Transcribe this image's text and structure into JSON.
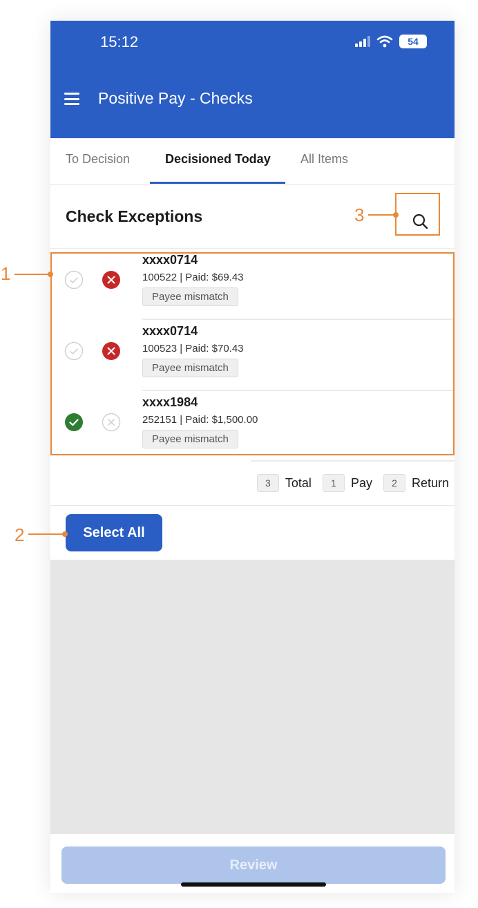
{
  "status": {
    "time": "15:12",
    "battery": "54"
  },
  "header": {
    "title": "Positive Pay - Checks"
  },
  "tabs": [
    {
      "label": "To Decision"
    },
    {
      "label": "Decisioned Today"
    },
    {
      "label": "All Items"
    }
  ],
  "section": {
    "title": "Check Exceptions"
  },
  "items": [
    {
      "account": "xxxx0714",
      "detail": "100522 | Paid: $69.43",
      "tag": "Payee mismatch",
      "decision": "return"
    },
    {
      "account": "xxxx0714",
      "detail": "100523 | Paid: $70.43",
      "tag": "Payee mismatch",
      "decision": "return"
    },
    {
      "account": "xxxx1984",
      "detail": "252151 | Paid: $1,500.00",
      "tag": "Payee mismatch",
      "decision": "pay"
    }
  ],
  "totals": {
    "total_count": "3",
    "total_label": "Total",
    "pay_count": "1",
    "pay_label": "Pay",
    "return_count": "2",
    "return_label": "Return"
  },
  "buttons": {
    "select_all": "Select All",
    "review": "Review"
  },
  "annotations": {
    "list": "1",
    "select_all": "2",
    "search": "3"
  },
  "icons": {
    "menu": "hamburger-icon",
    "search": "search-icon",
    "approve": "check-circle-icon",
    "reject": "x-circle-icon"
  },
  "colors": {
    "brand": "#2a5ec4",
    "approve": "#2e7d32",
    "reject": "#c62828",
    "annotation": "#e8893a"
  }
}
